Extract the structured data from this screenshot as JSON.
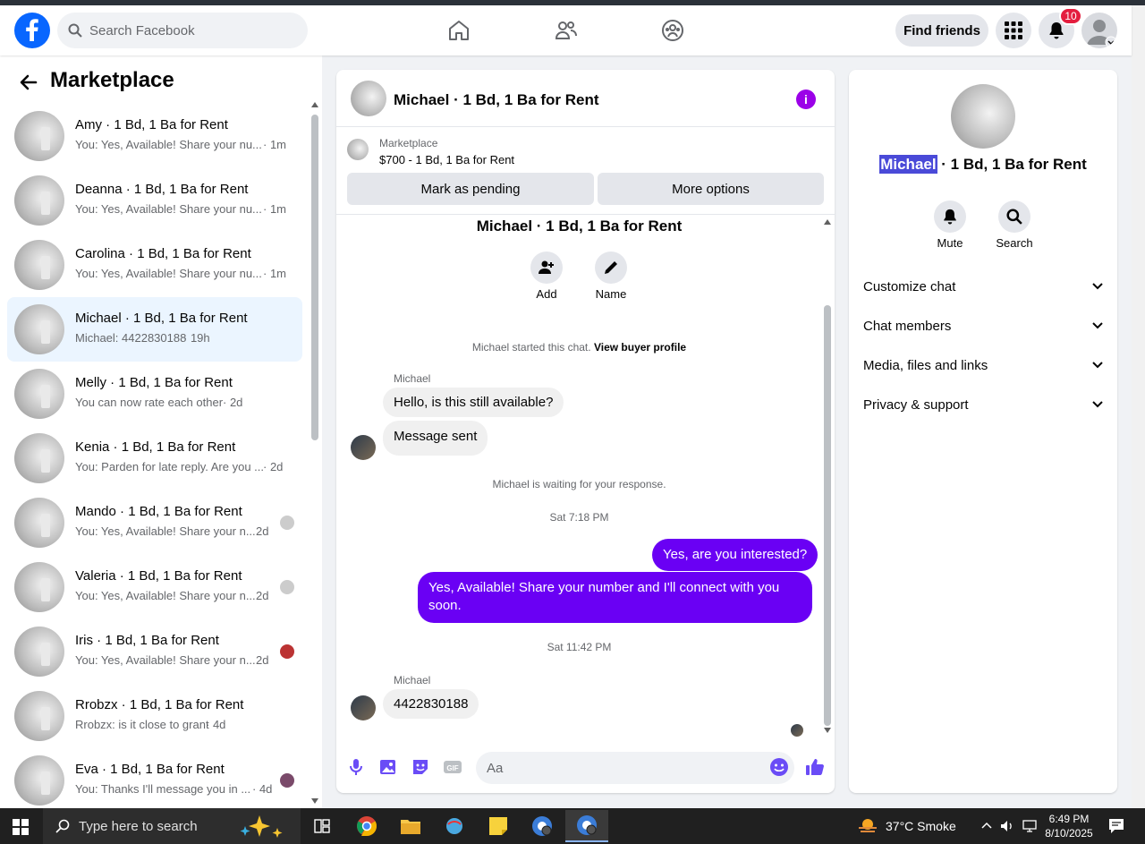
{
  "topbar": {
    "search_placeholder": "Search Facebook",
    "find_friends": "Find friends",
    "notification_count": "10"
  },
  "sidebar": {
    "title": "Marketplace",
    "conversations": [
      {
        "name": "Amy · 1 Bd, 1 Ba for Rent",
        "preview": "You: Yes, Available! Share your nu...",
        "time": "· 1m"
      },
      {
        "name": "Deanna · 1 Bd, 1 Ba for Rent",
        "preview": "You: Yes, Available! Share your nu...",
        "time": "· 1m"
      },
      {
        "name": "Carolina · 1 Bd, 1 Ba for Rent",
        "preview": "You: Yes, Available! Share your nu...",
        "time": "· 1m"
      },
      {
        "name": "Michael · 1 Bd, 1 Ba for Rent",
        "preview": "Michael: 4422830188",
        "time": "· 19h"
      },
      {
        "name": "Melly · 1 Bd, 1 Ba for Rent",
        "preview": "You can now rate each other",
        "time": "· 2d"
      },
      {
        "name": "Kenia · 1 Bd, 1 Ba for Rent",
        "preview": "You: Parden for late reply. Are you ...",
        "time": "· 2d"
      },
      {
        "name": "Mando · 1 Bd, 1 Ba for Rent",
        "preview": "You: Yes, Available! Share your n...",
        "time": "2d"
      },
      {
        "name": "Valeria · 1 Bd, 1 Ba for Rent",
        "preview": "You: Yes, Available! Share your n...",
        "time": "2d"
      },
      {
        "name": "Iris · 1 Bd, 1 Ba for Rent",
        "preview": "You: Yes, Available! Share your n...",
        "time": "2d"
      },
      {
        "name": "Rrobzx · 1 Bd, 1 Ba for Rent",
        "preview": "Rrobzx: is it close to grant",
        "time": "· 4d"
      },
      {
        "name": "Eva · 1 Bd, 1 Ba for Rent",
        "preview": "You: Thanks I'll message you in ...",
        "time": "· 4d"
      }
    ]
  },
  "chat": {
    "header_title": "Michael · 1 Bd, 1 Ba for Rent",
    "marketplace_label": "Marketplace",
    "listing": "$700 - 1 Bd, 1 Ba for Rent",
    "mark_pending": "Mark as pending",
    "more_options": "More options",
    "center_title": "Michael · 1 Bd, 1 Ba for Rent",
    "add_label": "Add",
    "name_label": "Name",
    "started_text": "Michael started this chat.",
    "buyer_profile_link": "View buyer profile",
    "sender_name": "Michael",
    "msg1": "Hello, is this still available?",
    "msg2": "Message sent",
    "waiting": "Michael is waiting for your response.",
    "time1": "Sat 7:18 PM",
    "out1": "Yes, are you interested?",
    "out2": "Yes, Available! Share your number and I'll connect with you soon.",
    "time2": "Sat 11:42 PM",
    "sender_name2": "Michael",
    "msg3": "4422830188",
    "input_placeholder": "Aa"
  },
  "details": {
    "name_highlight": "Michael",
    "name_rest": " · 1 Bd, 1 Ba for Rent",
    "mute": "Mute",
    "search": "Search",
    "sections": [
      "Customize chat",
      "Chat members",
      "Media, files and links",
      "Privacy & support"
    ]
  },
  "taskbar": {
    "search_placeholder": "Type here to search",
    "weather": "37°C  Smoke",
    "time": "6:49 PM",
    "date": "8/10/2025"
  },
  "colors": {
    "brand": "#0866ff",
    "outgoing_bubble": "#6a00f4",
    "info_icon": "#9b00e8",
    "notification_badge": "#e41e3f"
  }
}
